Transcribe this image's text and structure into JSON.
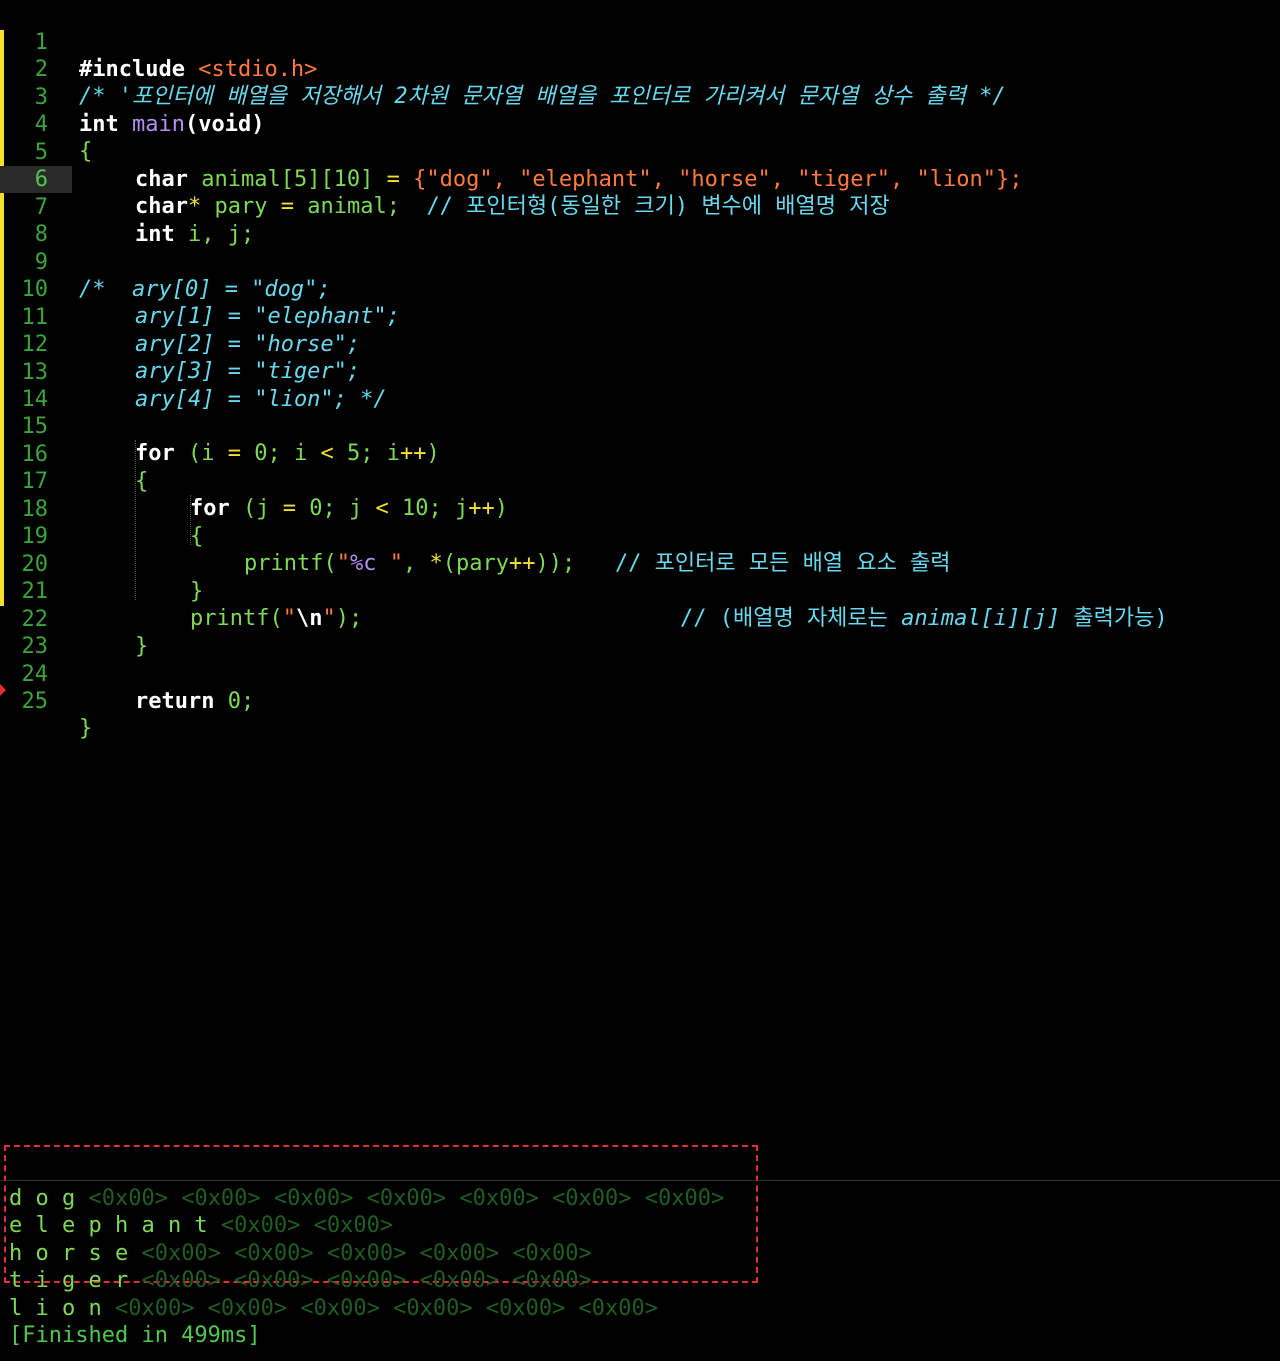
{
  "editor": {
    "lines": [
      {
        "n": "1",
        "t": "#include ",
        "s": "<stdio.h>"
      },
      {
        "n": "2",
        "t": "/* '포인터에 배열을 저장해서 2차원 문자열 배열을 포인터로 가리켜서 문자열 상수 출력 */"
      },
      {
        "n": "3",
        "a": "int ",
        "b": "main",
        "c": "(void)"
      },
      {
        "n": "4",
        "t": "{"
      },
      {
        "n": "5",
        "a": "char ",
        "b": "animal[5][10] ",
        "c": "= ",
        "d": "{\"dog\", \"elephant\", \"horse\", \"tiger\", \"lion\"};"
      },
      {
        "n": "6",
        "a": "char",
        "b": "* ",
        "c": "pary ",
        "d": "= ",
        "e": "animal;  ",
        "f": "// 포인터형(동일한 크기) 변수에 배열명 저장"
      },
      {
        "n": "7",
        "a": "int ",
        "b": "i, j;"
      },
      {
        "n": "8",
        "t": ""
      },
      {
        "n": "9",
        "t": "/*  ary[0] = \"dog\";"
      },
      {
        "n": "10",
        "t": "ary[1] = \"elephant\";"
      },
      {
        "n": "11",
        "t": "ary[2] = \"horse\";"
      },
      {
        "n": "12",
        "t": "ary[3] = \"tiger\";"
      },
      {
        "n": "13",
        "t": "ary[4] = \"lion\"; */"
      },
      {
        "n": "14",
        "t": ""
      },
      {
        "n": "15",
        "a": "for ",
        "b": "(i ",
        "c": "= ",
        "d": "0; i ",
        "e": "< ",
        "f": "5; i",
        "g": "++",
        "h": ")"
      },
      {
        "n": "16",
        "t": "{"
      },
      {
        "n": "17",
        "a": "for ",
        "b": "(j ",
        "c": "= ",
        "d": "0; j ",
        "e": "< ",
        "f": "10; j",
        "g": "++",
        "h": ")"
      },
      {
        "n": "18",
        "t": "{"
      },
      {
        "n": "19",
        "a": "printf(",
        "b": "\"",
        "c": "%c",
        "d": " \"",
        "e": ", ",
        "f": "*",
        "g": "(pary",
        "h": "++",
        "i": "));   ",
        "j": "// 포인터로 모든 배열 요소 출력"
      },
      {
        "n": "20",
        "a": "}",
        "b": "// (배열명 자체로는 ",
        "c": "animal[i][j]",
        "d": " 출력가능)"
      },
      {
        "n": "21",
        "a": "printf(",
        "b": "\"",
        "c": "\\n",
        "d": "\"",
        "e": ");"
      },
      {
        "n": "22",
        "t": "}"
      },
      {
        "n": "23",
        "t": ""
      },
      {
        "n": "24",
        "a": "return ",
        "b": "0;"
      },
      {
        "n": "25",
        "t": "}"
      }
    ]
  },
  "output": {
    "rows": [
      {
        "chars": "d o g ",
        "hex": "<0x00> <0x00> <0x00> <0x00> <0x00> <0x00> <0x00>"
      },
      {
        "chars": "e l e p h a n t ",
        "hex": "<0x00> <0x00>"
      },
      {
        "chars": "h o r s e ",
        "hex": "<0x00> <0x00> <0x00> <0x00> <0x00>"
      },
      {
        "chars": "t i g e r ",
        "hex": "<0x00> <0x00> <0x00> <0x00> <0x00>"
      },
      {
        "chars": "l i o n ",
        "hex": "<0x00> <0x00> <0x00> <0x00> <0x00> <0x00>"
      }
    ],
    "finished": "[Finished in 499ms]"
  },
  "colors": {
    "selection_box": "#e03030",
    "gutter_modified": "#f5e12b"
  }
}
